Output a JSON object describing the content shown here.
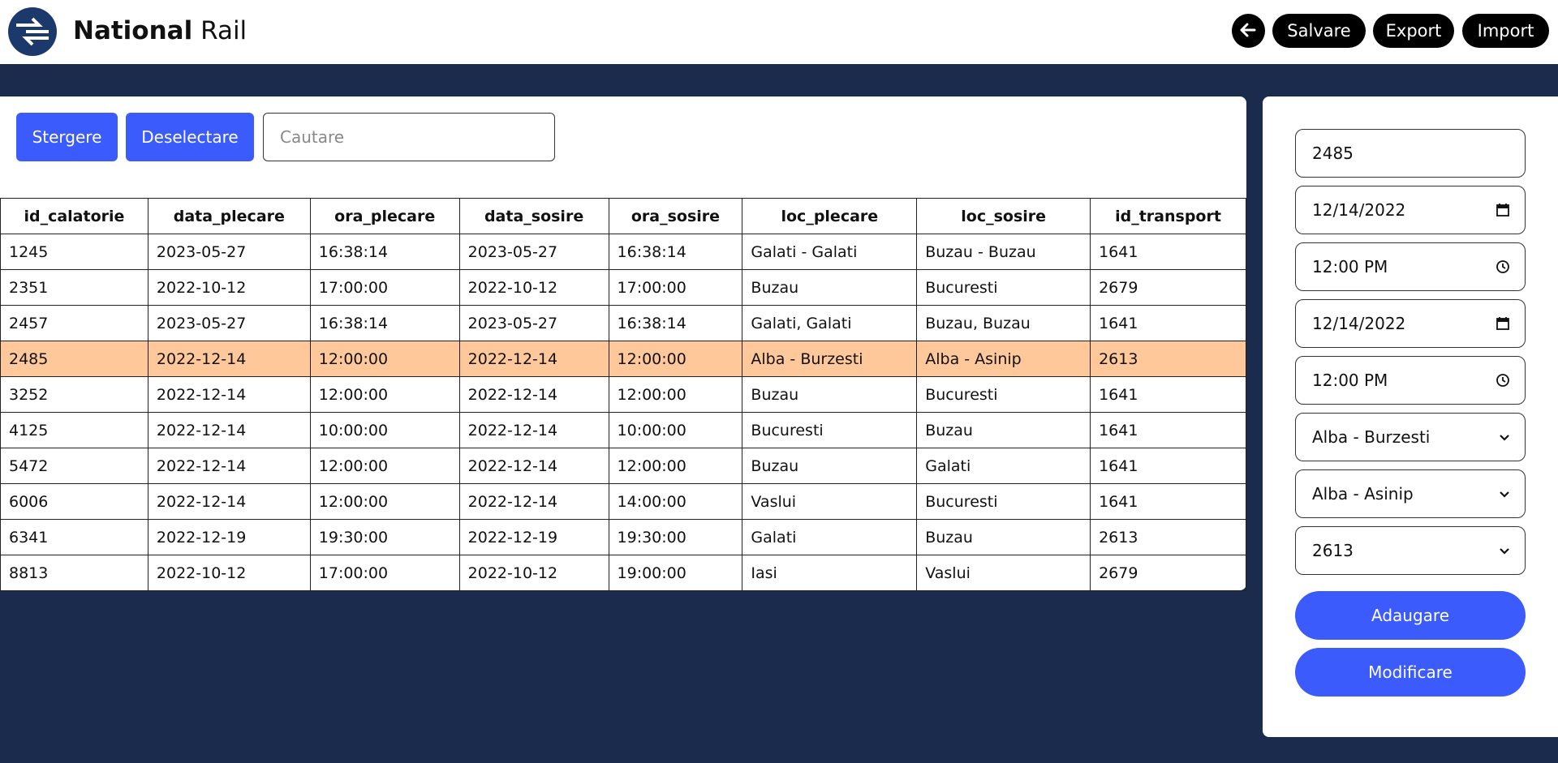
{
  "brand": {
    "bold": "National",
    "light": "Rail"
  },
  "header": {
    "save_label": "Salvare",
    "export_label": "Export",
    "import_label": "Import",
    "back_icon": "arrow-left-icon"
  },
  "toolbar": {
    "delete_label": "Stergere",
    "deselect_label": "Deselectare",
    "search_placeholder": "Cautare",
    "search_value": ""
  },
  "table": {
    "columns": [
      "id_calatorie",
      "data_plecare",
      "ora_plecare",
      "data_sosire",
      "ora_sosire",
      "loc_plecare",
      "loc_sosire",
      "id_transport"
    ],
    "selected_index": 3,
    "rows": [
      [
        "1245",
        "2023-05-27",
        "16:38:14",
        "2023-05-27",
        "16:38:14",
        "Galati - Galati",
        "Buzau - Buzau",
        "1641"
      ],
      [
        "2351",
        "2022-10-12",
        "17:00:00",
        "2022-10-12",
        "17:00:00",
        "Buzau",
        "Bucuresti",
        "2679"
      ],
      [
        "2457",
        "2023-05-27",
        "16:38:14",
        "2023-05-27",
        "16:38:14",
        "Galati, Galati",
        "Buzau, Buzau",
        "1641"
      ],
      [
        "2485",
        "2022-12-14",
        "12:00:00",
        "2022-12-14",
        "12:00:00",
        "Alba - Burzesti",
        "Alba - Asinip",
        "2613"
      ],
      [
        "3252",
        "2022-12-14",
        "12:00:00",
        "2022-12-14",
        "12:00:00",
        "Buzau",
        "Bucuresti",
        "1641"
      ],
      [
        "4125",
        "2022-12-14",
        "10:00:00",
        "2022-12-14",
        "10:00:00",
        "Bucuresti",
        "Buzau",
        "1641"
      ],
      [
        "5472",
        "2022-12-14",
        "12:00:00",
        "2022-12-14",
        "12:00:00",
        "Buzau",
        "Galati",
        "1641"
      ],
      [
        "6006",
        "2022-12-14",
        "12:00:00",
        "2022-12-14",
        "14:00:00",
        "Vaslui",
        "Bucuresti",
        "1641"
      ],
      [
        "6341",
        "2022-12-19",
        "19:30:00",
        "2022-12-19",
        "19:30:00",
        "Galati",
        "Buzau",
        "2613"
      ],
      [
        "8813",
        "2022-10-12",
        "17:00:00",
        "2022-10-12",
        "19:00:00",
        "Iasi",
        "Vaslui",
        "2679"
      ]
    ]
  },
  "form": {
    "id_calatorie": "2485",
    "data_plecare": "12/14/2022",
    "ora_plecare": "12:00 PM",
    "data_sosire": "12/14/2022",
    "ora_sosire": "12:00 PM",
    "loc_plecare": "Alba - Burzesti",
    "loc_sosire": "Alba - Asinip",
    "id_transport": "2613",
    "add_label": "Adaugare",
    "modify_label": "Modificare"
  },
  "colors": {
    "accent": "#3b5bfd",
    "background": "#1b2b4d",
    "selected_row": "#ffc89a",
    "logo": "#1b3a6b"
  }
}
